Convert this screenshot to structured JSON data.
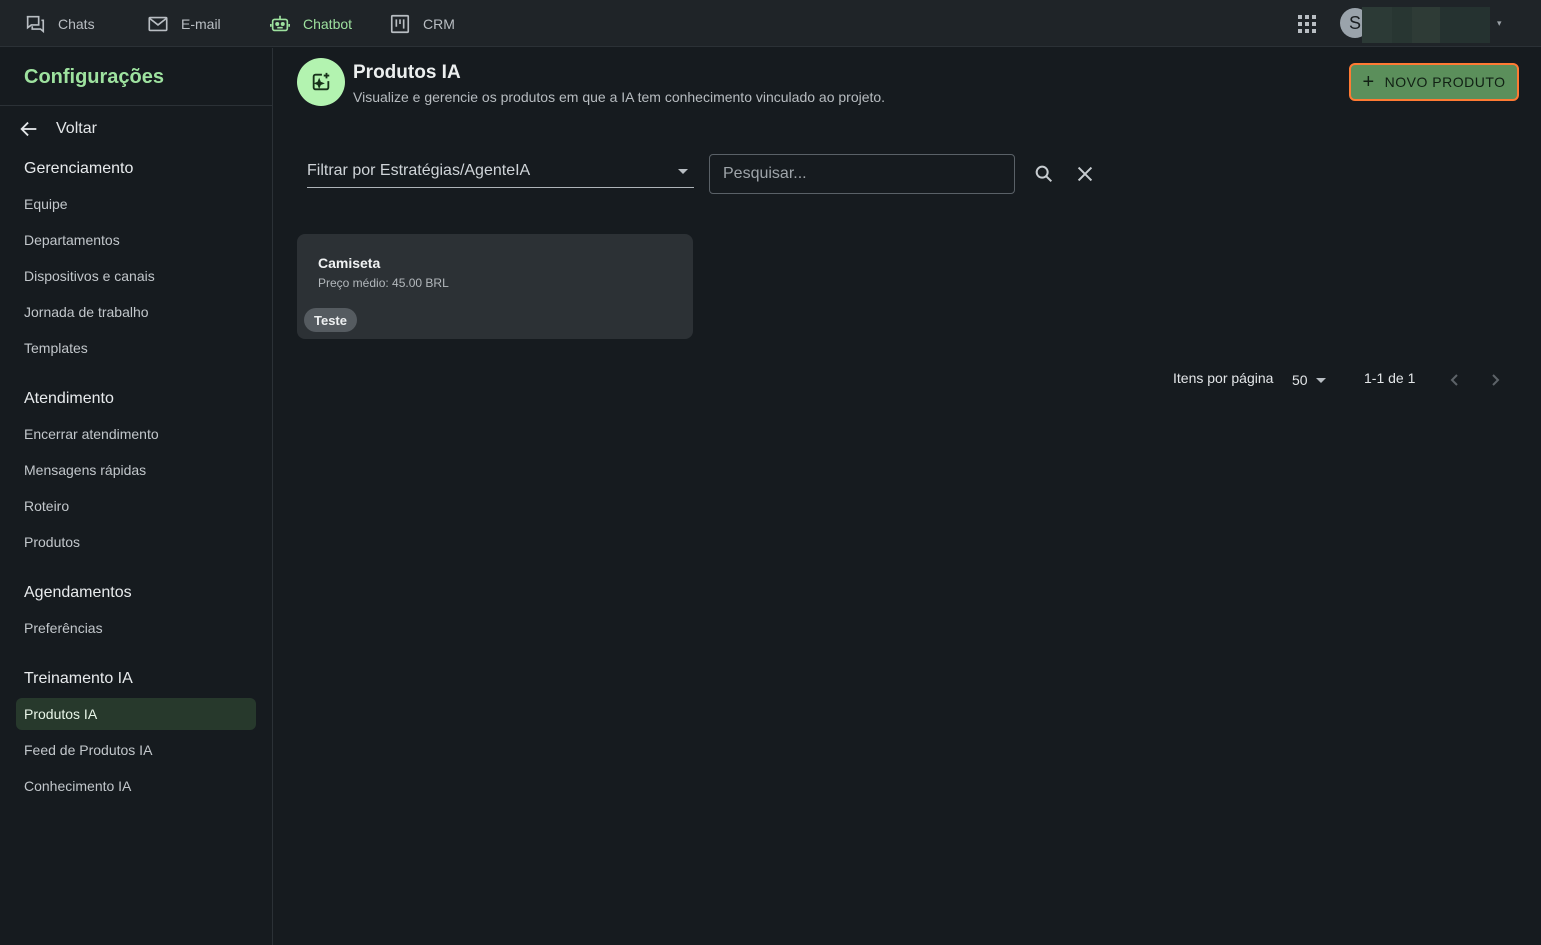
{
  "topnav": {
    "items": [
      {
        "label": "Chats",
        "icon": "chat-bubbles-icon"
      },
      {
        "label": "E-mail",
        "icon": "mail-icon"
      },
      {
        "label": "Chatbot",
        "icon": "robot-icon"
      },
      {
        "label": "CRM",
        "icon": "kanban-icon"
      }
    ],
    "active": "Chatbot",
    "avatar_initial": "S"
  },
  "sidebar": {
    "title": "Configurações",
    "back_label": "Voltar",
    "sections": [
      {
        "title": "Gerenciamento",
        "items": [
          "Equipe",
          "Departamentos",
          "Dispositivos e canais",
          "Jornada de trabalho",
          "Templates"
        ]
      },
      {
        "title": "Atendimento",
        "items": [
          "Encerrar atendimento",
          "Mensagens rápidas",
          "Roteiro",
          "Produtos"
        ]
      },
      {
        "title": "Agendamentos",
        "items": [
          "Preferências"
        ]
      },
      {
        "title": "Treinamento IA",
        "items": [
          "Produtos IA",
          "Feed de Produtos IA",
          "Conhecimento IA"
        ]
      }
    ],
    "active_item": "Produtos IA"
  },
  "header": {
    "title": "Produtos IA",
    "subtitle": "Visualize e gerencie os produtos em que a IA tem conhecimento vinculado ao projeto.",
    "new_button_label": "NOVO PRODUTO"
  },
  "filters": {
    "strategy_placeholder": "Filtrar por Estratégias/AgenteIA",
    "search_placeholder": "Pesquisar..."
  },
  "products": [
    {
      "name": "Camiseta",
      "price": "Preço médio: 45.00 BRL",
      "tag": "Teste"
    }
  ],
  "pagination": {
    "per_page_label": "Itens por página",
    "per_page_value": "50",
    "range": "1-1 de 1"
  },
  "colors": {
    "accent": "#9ee29f",
    "background": "#161b1f",
    "topbar": "#1f2428",
    "card": "#2c3135",
    "primary_button": "#5b8f5b",
    "button_highlight": "#ff7a33"
  }
}
